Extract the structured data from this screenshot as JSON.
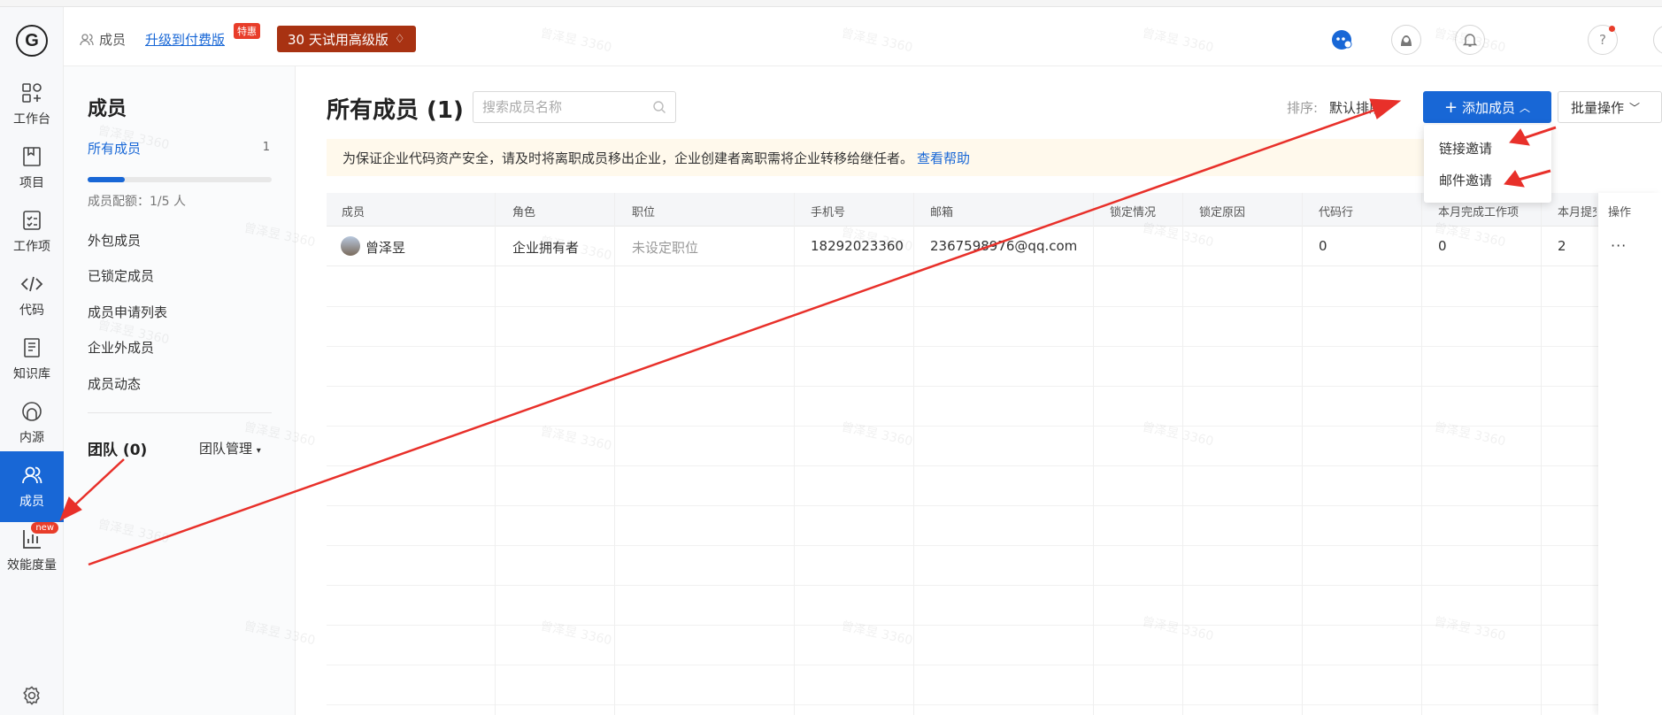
{
  "header": {
    "breadcrumb": "成员",
    "upgrade_link": "升级到付费版",
    "upgrade_badge": "特惠",
    "trial_button": "30 天试用高级版"
  },
  "rail": {
    "logo": "G",
    "items": [
      {
        "label": "工作台",
        "icon": "dashboard-icon"
      },
      {
        "label": "项目",
        "icon": "project-icon"
      },
      {
        "label": "工作项",
        "icon": "task-icon"
      },
      {
        "label": "代码",
        "icon": "code-icon"
      },
      {
        "label": "知识库",
        "icon": "book-icon"
      },
      {
        "label": "内源",
        "icon": "inner-source-icon"
      },
      {
        "label": "成员",
        "icon": "members-icon",
        "active": true
      },
      {
        "label": "效能度量",
        "icon": "metrics-icon",
        "badge": "new"
      }
    ]
  },
  "side": {
    "title": "成员",
    "all_members": "所有成员",
    "all_count": "1",
    "quota_text": "成员配额：1/5 人",
    "quota_fraction": 0.2,
    "links": [
      "外包成员",
      "已锁定成员",
      "成员申请列表",
      "企业外成员",
      "成员动态"
    ],
    "team_title": "团队 (0)",
    "team_manage": "团队管理"
  },
  "main": {
    "title": "所有成员 (1)",
    "search_placeholder": "搜索成员名称",
    "sort_label": "排序:",
    "sort_value": "默认排序",
    "add_button": "添加成员",
    "batch_button": "批量操作",
    "dropdown": [
      "链接邀请",
      "邮件邀请"
    ],
    "notice": "为保证企业代码资产安全，请及时将离职成员移出企业，企业创建者离职需将企业转移给继任者。",
    "notice_link": "查看帮助"
  },
  "table": {
    "columns": [
      "成员",
      "角色",
      "职位",
      "手机号",
      "邮箱",
      "锁定情况",
      "锁定原因",
      "代码行",
      "本月完成工作项",
      "本月提交",
      "操作"
    ],
    "rows": [
      {
        "name": "曾泽昱",
        "role": "企业拥有者",
        "position": "未设定职位",
        "phone": "18292023360",
        "email": "2367598976@qq.com",
        "lock_status": "",
        "lock_reason": "",
        "code_lines": "0",
        "tasks_done": "0",
        "commits": "2",
        "action": "···"
      }
    ]
  },
  "watermark": "曾泽昱 3360",
  "colors": {
    "accent": "#1867d6",
    "trial": "#a83212",
    "badge": "#e83d2a",
    "arrow": "#e8302a"
  }
}
